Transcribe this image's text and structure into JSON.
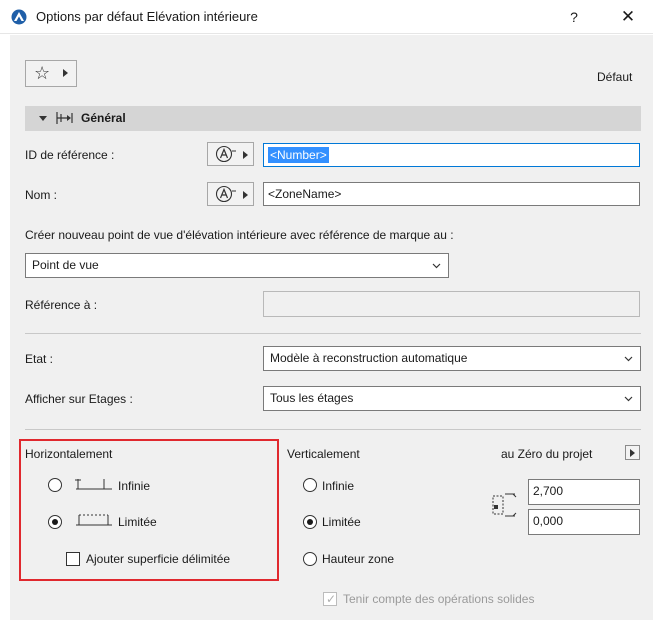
{
  "window": {
    "title": "Options par défaut Elévation intérieure",
    "help_label": "?",
    "close_label": "✕"
  },
  "toolbar": {
    "favorites_icon": "star-icon",
    "default_label": "Défaut"
  },
  "section": {
    "title": "Général"
  },
  "form": {
    "reference_id_label": "ID de référence :",
    "reference_id_value": "<Number>",
    "name_label": "Nom :",
    "name_value": "<ZoneName>",
    "create_viewpoint_label": "Créer nouveau point de vue d'élévation intérieure avec référence de marque au :",
    "create_viewpoint_value": "Point de vue",
    "reference_to_label": "Référence à :",
    "reference_to_value": "",
    "state_label": "Etat :",
    "state_value": "Modèle à reconstruction automatique",
    "show_on_stories_label": "Afficher sur Etages :",
    "show_on_stories_value": "Tous les étages"
  },
  "horizontal": {
    "heading": "Horizontalement",
    "infinite_label": "Infinie",
    "limited_label": "Limitée",
    "selected": "limited",
    "add_area_label": "Ajouter superficie délimitée",
    "add_area_checked": false
  },
  "vertical": {
    "heading": "Verticalement",
    "infinite_label": "Infinie",
    "limited_label": "Limitée",
    "zone_height_label": "Hauteur zone",
    "selected": "limited",
    "project_zero_label": "au Zéro du projet",
    "top_value": "2,700",
    "bottom_value": "0,000",
    "solid_ops_label": "Tenir compte des opérations solides",
    "solid_ops_checked": true
  },
  "colors": {
    "highlight_red": "#e0282e",
    "focus_blue": "#0078d7",
    "selection_blue": "#3390ff",
    "section_bar": "#d5d5d5",
    "dialog_bg": "#f0f0f0"
  }
}
